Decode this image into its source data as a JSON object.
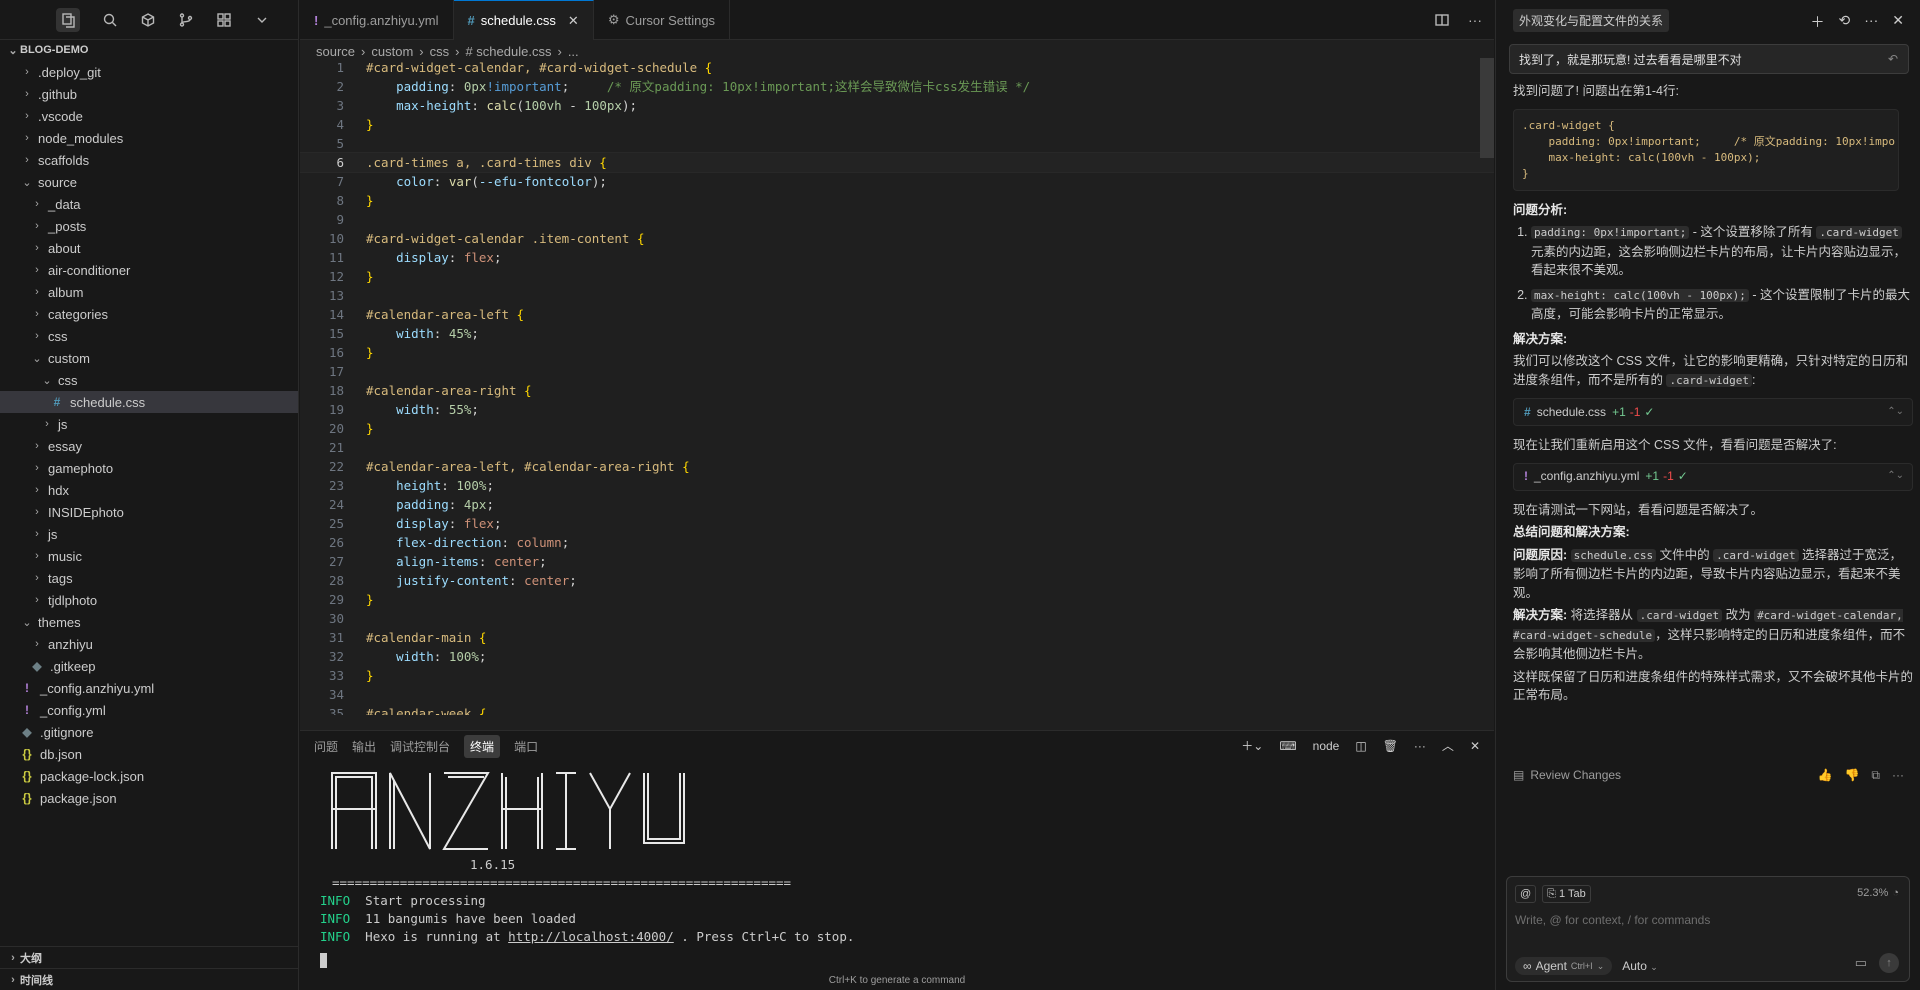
{
  "sidebar": {
    "title": "BLOG-DEMO",
    "tree": [
      {
        "label": ".deploy_git",
        "type": "folder",
        "depth": 1,
        "open": false
      },
      {
        "label": ".github",
        "type": "folder",
        "depth": 1,
        "open": false
      },
      {
        "label": ".vscode",
        "type": "folder",
        "depth": 1,
        "open": false
      },
      {
        "label": "node_modules",
        "type": "folder",
        "depth": 1,
        "open": false
      },
      {
        "label": "scaffolds",
        "type": "folder",
        "depth": 1,
        "open": false
      },
      {
        "label": "source",
        "type": "folder",
        "depth": 1,
        "open": true
      },
      {
        "label": "_data",
        "type": "folder",
        "depth": 2,
        "open": false
      },
      {
        "label": "_posts",
        "type": "folder",
        "depth": 2,
        "open": false
      },
      {
        "label": "about",
        "type": "folder",
        "depth": 2,
        "open": false
      },
      {
        "label": "air-conditioner",
        "type": "folder",
        "depth": 2,
        "open": false
      },
      {
        "label": "album",
        "type": "folder",
        "depth": 2,
        "open": false
      },
      {
        "label": "categories",
        "type": "folder",
        "depth": 2,
        "open": false
      },
      {
        "label": "css",
        "type": "folder",
        "depth": 2,
        "open": false
      },
      {
        "label": "custom",
        "type": "folder",
        "depth": 2,
        "open": true
      },
      {
        "label": "css",
        "type": "folder",
        "depth": 3,
        "open": true
      },
      {
        "label": "schedule.css",
        "type": "css",
        "depth": 4,
        "selected": true
      },
      {
        "label": "js",
        "type": "folder",
        "depth": 3,
        "open": false
      },
      {
        "label": "essay",
        "type": "folder",
        "depth": 2,
        "open": false
      },
      {
        "label": "gamephoto",
        "type": "folder",
        "depth": 2,
        "open": false
      },
      {
        "label": "hdx",
        "type": "folder",
        "depth": 2,
        "open": false
      },
      {
        "label": "INSIDEphoto",
        "type": "folder",
        "depth": 2,
        "open": false
      },
      {
        "label": "js",
        "type": "folder",
        "depth": 2,
        "open": false
      },
      {
        "label": "music",
        "type": "folder",
        "depth": 2,
        "open": false
      },
      {
        "label": "tags",
        "type": "folder",
        "depth": 2,
        "open": false
      },
      {
        "label": "tjdlphoto",
        "type": "folder",
        "depth": 2,
        "open": false
      },
      {
        "label": "themes",
        "type": "folder",
        "depth": 1,
        "open": true
      },
      {
        "label": "anzhiyu",
        "type": "folder",
        "depth": 2,
        "open": false
      },
      {
        "label": ".gitkeep",
        "type": "git",
        "depth": 2
      },
      {
        "label": "_config.anzhiyu.yml",
        "type": "yml",
        "depth": 1
      },
      {
        "label": "_config.yml",
        "type": "yml",
        "depth": 1
      },
      {
        "label": ".gitignore",
        "type": "git",
        "depth": 1
      },
      {
        "label": "db.json",
        "type": "json",
        "depth": 1
      },
      {
        "label": "package-lock.json",
        "type": "json",
        "depth": 1
      },
      {
        "label": "package.json",
        "type": "json",
        "depth": 1
      }
    ],
    "outline": "大纲",
    "timeline": "时间线"
  },
  "editor": {
    "tabs": [
      {
        "icon": "!",
        "label": "_config.anzhiyu.yml"
      },
      {
        "icon": "#",
        "label": "schedule.css"
      },
      {
        "icon": "⚙",
        "label": "Cursor Settings"
      }
    ],
    "breadcrumb": [
      "source",
      "custom",
      "css",
      "# schedule.css",
      "..."
    ],
    "code": [
      [
        [
          "t-sel",
          "#card-widget-calendar, #card-widget-schedule "
        ],
        [
          "t-br",
          "{"
        ]
      ],
      [
        [
          "",
          "    "
        ],
        [
          "t-prop",
          "padding"
        ],
        [
          "",
          ": "
        ],
        [
          "t-num",
          "0px"
        ],
        [
          "t-imp",
          "!important"
        ],
        [
          "",
          ";     "
        ],
        [
          "t-com",
          "/* 原文padding: 10px!important;这样会导致微信卡css发生错误 */"
        ]
      ],
      [
        [
          "",
          "    "
        ],
        [
          "t-prop",
          "max-height"
        ],
        [
          "",
          ": "
        ],
        [
          "t-fn",
          "calc"
        ],
        [
          "",
          "("
        ],
        [
          "t-num",
          "100vh"
        ],
        [
          "",
          " - "
        ],
        [
          "t-num",
          "100px"
        ],
        [
          "",
          ");"
        ]
      ],
      [
        [
          "t-br",
          "}"
        ]
      ],
      [
        [
          "",
          ""
        ]
      ],
      [
        [
          "t-sel",
          ".card-times a, .card-times div "
        ],
        [
          "t-br",
          "{"
        ]
      ],
      [
        [
          "",
          "    "
        ],
        [
          "t-prop",
          "color"
        ],
        [
          "",
          ": "
        ],
        [
          "t-fn",
          "var"
        ],
        [
          "",
          "("
        ],
        [
          "t-prop",
          "--efu-fontcolor"
        ],
        [
          "",
          ");"
        ]
      ],
      [
        [
          "t-br",
          "}"
        ]
      ],
      [
        [
          "",
          ""
        ]
      ],
      [
        [
          "t-sel",
          "#card-widget-calendar .item-content "
        ],
        [
          "t-br",
          "{"
        ]
      ],
      [
        [
          "",
          "    "
        ],
        [
          "t-prop",
          "display"
        ],
        [
          "",
          ": "
        ],
        [
          "t-str",
          "flex"
        ],
        [
          "",
          ";"
        ]
      ],
      [
        [
          "t-br",
          "}"
        ]
      ],
      [
        [
          "",
          ""
        ]
      ],
      [
        [
          "t-sel",
          "#calendar-area-left "
        ],
        [
          "t-br",
          "{"
        ]
      ],
      [
        [
          "",
          "    "
        ],
        [
          "t-prop",
          "width"
        ],
        [
          "",
          ": "
        ],
        [
          "t-num",
          "45%"
        ],
        [
          "",
          ";"
        ]
      ],
      [
        [
          "t-br",
          "}"
        ]
      ],
      [
        [
          "",
          ""
        ]
      ],
      [
        [
          "t-sel",
          "#calendar-area-right "
        ],
        [
          "t-br",
          "{"
        ]
      ],
      [
        [
          "",
          "    "
        ],
        [
          "t-prop",
          "width"
        ],
        [
          "",
          ": "
        ],
        [
          "t-num",
          "55%"
        ],
        [
          "",
          ";"
        ]
      ],
      [
        [
          "t-br",
          "}"
        ]
      ],
      [
        [
          "",
          ""
        ]
      ],
      [
        [
          "t-sel",
          "#calendar-area-left, #calendar-area-right "
        ],
        [
          "t-br",
          "{"
        ]
      ],
      [
        [
          "",
          "    "
        ],
        [
          "t-prop",
          "height"
        ],
        [
          "",
          ": "
        ],
        [
          "t-num",
          "100%"
        ],
        [
          "",
          ";"
        ]
      ],
      [
        [
          "",
          "    "
        ],
        [
          "t-prop",
          "padding"
        ],
        [
          "",
          ": "
        ],
        [
          "t-num",
          "4px"
        ],
        [
          "",
          ";"
        ]
      ],
      [
        [
          "",
          "    "
        ],
        [
          "t-prop",
          "display"
        ],
        [
          "",
          ": "
        ],
        [
          "t-str",
          "flex"
        ],
        [
          "",
          ";"
        ]
      ],
      [
        [
          "",
          "    "
        ],
        [
          "t-prop",
          "flex-direction"
        ],
        [
          "",
          ": "
        ],
        [
          "t-str",
          "column"
        ],
        [
          "",
          ";"
        ]
      ],
      [
        [
          "",
          "    "
        ],
        [
          "t-prop",
          "align-items"
        ],
        [
          "",
          ": "
        ],
        [
          "t-str",
          "center"
        ],
        [
          "",
          ";"
        ]
      ],
      [
        [
          "",
          "    "
        ],
        [
          "t-prop",
          "justify-content"
        ],
        [
          "",
          ": "
        ],
        [
          "t-str",
          "center"
        ],
        [
          "",
          ";"
        ]
      ],
      [
        [
          "t-br",
          "}"
        ]
      ],
      [
        [
          "",
          ""
        ]
      ],
      [
        [
          "t-sel",
          "#calendar-main "
        ],
        [
          "t-br",
          "{"
        ]
      ],
      [
        [
          "",
          "    "
        ],
        [
          "t-prop",
          "width"
        ],
        [
          "",
          ": "
        ],
        [
          "t-num",
          "100%"
        ],
        [
          "",
          ";"
        ]
      ],
      [
        [
          "t-br",
          "}"
        ]
      ],
      [
        [
          "",
          ""
        ]
      ],
      [
        [
          "t-sel",
          "#calendar-week "
        ],
        [
          "t-br",
          "{"
        ]
      ]
    ],
    "current_line": 6
  },
  "panel": {
    "tabs": [
      "问题",
      "输出",
      "调试控制台",
      "终端",
      "端口"
    ],
    "active_tab": "终端",
    "shell": "node",
    "ascii_art": "ANZHIYU",
    "version": "1.6.15",
    "divider": "=============================================================",
    "lines": [
      {
        "level": "INFO",
        "text": "Start processing"
      },
      {
        "level": "INFO",
        "text": "11 bangumis have been loaded"
      },
      {
        "level": "INFO",
        "text": "Hexo is running at ",
        "url": "http://localhost:4000/",
        "suffix": " . Press Ctrl+C to stop."
      }
    ],
    "hint": "Ctrl+K to generate a command"
  },
  "chat": {
    "title": "外观变化与配置文件的关系",
    "user_message": "找到了，就是那玩意! 过去看看是哪里不对",
    "found_text": "找到问题了! 问题出在第1-4行:",
    "codeblock": ".card-widget {\n    padding: 0px!important;     /* 原文padding: 10px!impo\n    max-height: calc(100vh - 100px);\n}",
    "analysis_title": "问题分析:",
    "points": [
      {
        "code": "padding: 0px!important;",
        "text_a": " - 这个设置移除了所有 ",
        "code2": ".card-widget",
        "text_b": " 元素的内边距，这会影响侧边栏卡片的布局，让卡片内容贴边显示，看起来很不美观。"
      },
      {
        "code": "max-height: calc(100vh - 100px);",
        "text_a": " - 这个设置限制了卡片的最大高度，可能会影响卡片的正常显示。",
        "code2": "",
        "text_b": ""
      }
    ],
    "solution_title": "解决方案:",
    "solution_text": "我们可以修改这个 CSS 文件，让它的影响更精确，只针对特定的日历和进度条组件，而不是所有的 ",
    "solution_code": ".card-widget",
    "solution_end": ":",
    "file1": {
      "icon": "#",
      "name": "schedule.css",
      "plus": "+1",
      "minus": "-1"
    },
    "reenable_text": "现在让我们重新启用这个 CSS 文件，看看问题是否解决了:",
    "file2": {
      "icon": "!",
      "name": "_config.anzhiyu.yml",
      "plus": "+1",
      "minus": "-1"
    },
    "test_text": "现在请测试一下网站，看看问题是否解决了。",
    "summary_title": "总结问题和解决方案:",
    "cause_label": "问题原因:",
    "cause_code1": "schedule.css",
    "cause_text1": " 文件中的 ",
    "cause_code2": ".card-widget",
    "cause_text2": " 选择器过于宽泛，影响了所有侧边栏卡片的内边距，导致卡片内容贴边显示，看起来不美观。",
    "fix_label": "解决方案:",
    "fix_text1": " 将选择器从 ",
    "fix_code1": ".card-widget",
    "fix_text2": " 改为 ",
    "fix_code2": "#card-widget-calendar, #card-widget-schedule",
    "fix_text3": "，这样只影响特定的日历和进度条组件，而不会影响其他侧边栏卡片。",
    "closing": "这样既保留了日历和进度条组件的特殊样式需求，又不会破坏其他卡片的正常布局。",
    "review": "Review Changes",
    "composer": {
      "at": "@",
      "tab_chip": "1 Tab",
      "percent": "52.3%",
      "placeholder": "Write, @ for context, / for commands",
      "agent": "Agent",
      "agent_kbd": "Ctrl+I",
      "model": "Auto"
    }
  }
}
